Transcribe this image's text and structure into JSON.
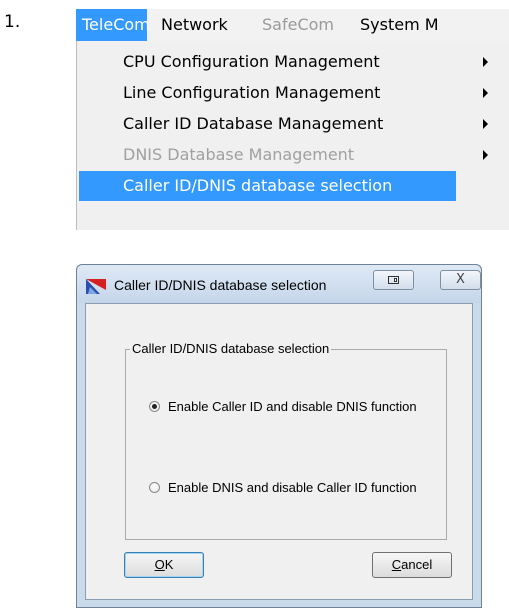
{
  "step": {
    "number": "1."
  },
  "menubar": {
    "items": [
      {
        "label": "TeleCom",
        "state": "active"
      },
      {
        "label": "Network",
        "state": "enabled"
      },
      {
        "label": "SafeCom",
        "state": "disabled"
      },
      {
        "label": "System M",
        "state": "enabled"
      }
    ]
  },
  "dropdown": {
    "items": [
      {
        "label": "CPU Configuration Management",
        "state": "enabled",
        "submenu": true
      },
      {
        "label": "Line Configuration Management",
        "state": "enabled",
        "submenu": true
      },
      {
        "label": "Caller ID Database Management",
        "state": "enabled",
        "submenu": true
      },
      {
        "label": "DNIS Database Management",
        "state": "disabled",
        "submenu": true
      },
      {
        "label": "Caller ID/DNIS database selection",
        "state": "selected",
        "submenu": false
      }
    ]
  },
  "dialog": {
    "title": "Caller ID/DNIS database selection",
    "close_glyph": "X",
    "group_label": "Caller ID/DNIS database selection",
    "options": [
      {
        "label": "Enable Caller ID and disable DNIS function",
        "checked": true
      },
      {
        "label": "Enable DNIS and disable Caller ID function",
        "checked": false
      }
    ],
    "ok_button": {
      "mnemonic": "O",
      "rest": "K"
    },
    "cancel_button": {
      "mnemonic": "C",
      "rest": "ancel"
    }
  },
  "colors": {
    "highlight": "#3399ff",
    "menu_background": "#f0f0f0",
    "dialog_frame": "#c9daeb",
    "disabled_text": "#a0a0a0"
  },
  "icons": {
    "submenu_arrow": "triangle-right",
    "app_icon": "telecom-app-icon",
    "restore": "restore-window-icon",
    "close": "close-x-icon"
  }
}
